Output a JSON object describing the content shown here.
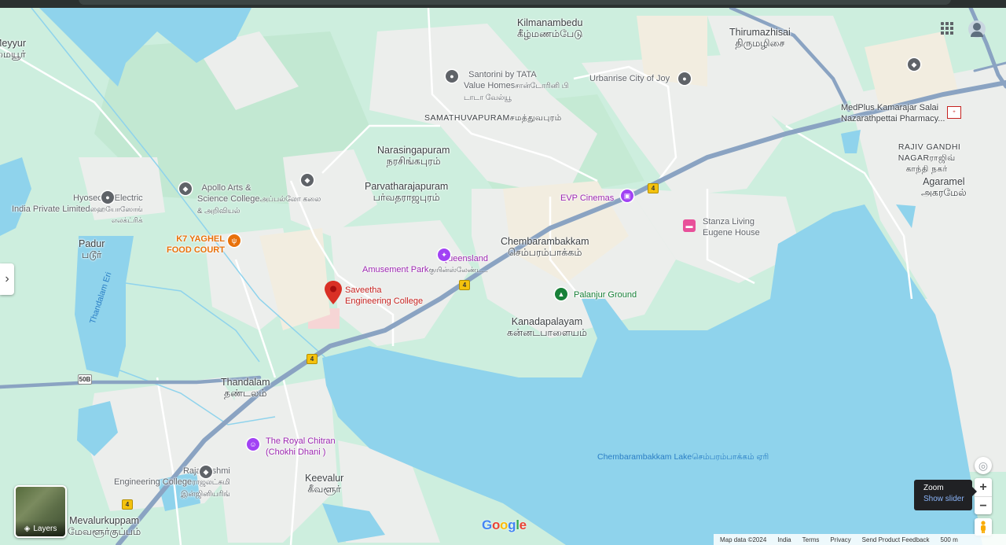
{
  "places": {
    "meyyur": {
      "en": "Meyyur",
      "ta": "மையூர்"
    },
    "kilmanambedu": {
      "en": "Kilmanambedu",
      "ta": "கீழ்மணம்பேடு"
    },
    "thirumazhisai": {
      "en": "Thirumazhisai",
      "ta": "திருமழிசை"
    },
    "samathuvapuram": {
      "en": "SAMATHUVAPURAM",
      "ta": "சமத்துவபுரம்"
    },
    "narasingapuram": {
      "en": "Narasingapuram",
      "ta": "நரசிங்கபுரம்"
    },
    "parvatharajapuram": {
      "en": "Parvatharajapuram",
      "ta": "பர்வதராஜபுரம்"
    },
    "rajiv_gandhi_nagar": {
      "en": "RAJIV GANDHI\nNAGAR",
      "ta": "ராஜிவ்\nகாந்தி நகர்"
    },
    "agaramel": {
      "en": "Agaramel",
      "ta": "அகரமேல்"
    },
    "padur": {
      "en": "Padur",
      "ta": "படூர்"
    },
    "chembarambakkam": {
      "en": "Chembarambakkam",
      "ta": "செம்பரம்பாக்கம்"
    },
    "kanadapalayam": {
      "en": "Kanadapalayam",
      "ta": "கன்னடபாளையம்"
    },
    "thandalam": {
      "en": "Thandalam",
      "ta": "தண்டலம்"
    },
    "keevalur": {
      "en": "Keevalur",
      "ta": "கீவளூர்"
    },
    "mevalurkuppam": {
      "en": "Mevalurkuppam",
      "ta": "மேவளூர்குப்பம்"
    }
  },
  "pois": {
    "santorini": {
      "en": "Santorini by TATA\nValue Homes",
      "ta": "சான்டோரினி பி\nடாடா வேல்யூ"
    },
    "urbanrise": {
      "en": "Urbanrise City of Joy"
    },
    "medplus": {
      "en": "MedPlus Kamarajar Salai\nNazarathpettai Pharmacy..."
    },
    "hyoseong": {
      "en": "Hyoseong Electric\nIndia Private Limited",
      "ta": "ஹையோஸோங்\nஎலக்ட்ரிக்"
    },
    "apollo": {
      "en": "Apollo Arts &\nScience College",
      "ta": "அப்பல்லோ கலை\n& அறிவியல்"
    },
    "k7": {
      "en": "K7 YAGHEL\nFOOD COURT"
    },
    "queensland": {
      "en": "Queensland\nAmusement Park",
      "ta": "குயின்ஸ்லேண்ட..."
    },
    "saveetha": {
      "en": "Saveetha\nEngineering College"
    },
    "evp": {
      "en": "EVP Cinemas"
    },
    "stanza": {
      "en": "Stanza Living\nEugene House"
    },
    "palanjur": {
      "en": "Palanjur Ground"
    },
    "royal_chitran": {
      "en": "The Royal Chitran\n(Chokhi Dhani )"
    },
    "rajalakshmi": {
      "en": "Rajalakshmi\nEngineering College",
      "ta": "ராஜலட்சுமி\nஇன்ஜினியரிங்"
    }
  },
  "water": {
    "thandalam_eri": "Thandalam Eri",
    "lake_en": "Chembarambakkam Lake",
    "lake_ta": "செம்பரம்பாக்கம் ஏரி"
  },
  "roads": {
    "nh4": "4",
    "r50b": "50B"
  },
  "controls": {
    "layers_label": "Layers",
    "zoom_in": "+",
    "zoom_out": "−",
    "tooltip_title": "Zoom",
    "tooltip_link": "Show slider",
    "expand": "›"
  },
  "brand": {
    "logo": "Google"
  },
  "footer": {
    "map_data": "Map data ©2024",
    "india": "India",
    "terms": "Terms",
    "privacy": "Privacy",
    "feedback": "Send Product Feedback",
    "scale": "500 m"
  },
  "icons": {
    "apps": "apps-grid-icon",
    "account": "account-icon",
    "location": "my-location-icon",
    "pegman": "pegman-icon"
  },
  "colors": {
    "land": "#cdeede",
    "urban": "#eef0ee",
    "water": "#8fd3ec",
    "highway": "#8aa3c2",
    "pin_red": "#d93025"
  }
}
